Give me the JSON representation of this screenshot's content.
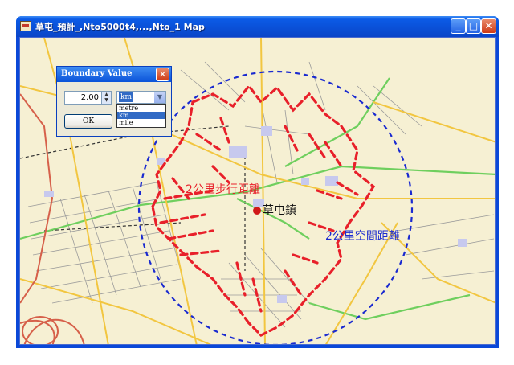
{
  "window": {
    "title": "草屯_預計_,Nto5000t4,...,Nto_1 Map",
    "minimize_label": "_",
    "maximize_label": "□",
    "close_label": "✕",
    "icon": "map-app-icon"
  },
  "dialog": {
    "title": "Boundary Value",
    "close_label": "✕",
    "value": "2.00",
    "unit_selected": "km",
    "unit_options": [
      "metre",
      "km",
      "mile"
    ],
    "ok_label": "OK"
  },
  "map": {
    "labels": {
      "walk": "2公里步行距離",
      "town": "草屯鎮",
      "space": "2公里空間距離"
    }
  },
  "colors": {
    "walk_boundary": "#e8202a",
    "space_boundary": "#1a2ad0",
    "map_background": "#f6f0d3"
  }
}
